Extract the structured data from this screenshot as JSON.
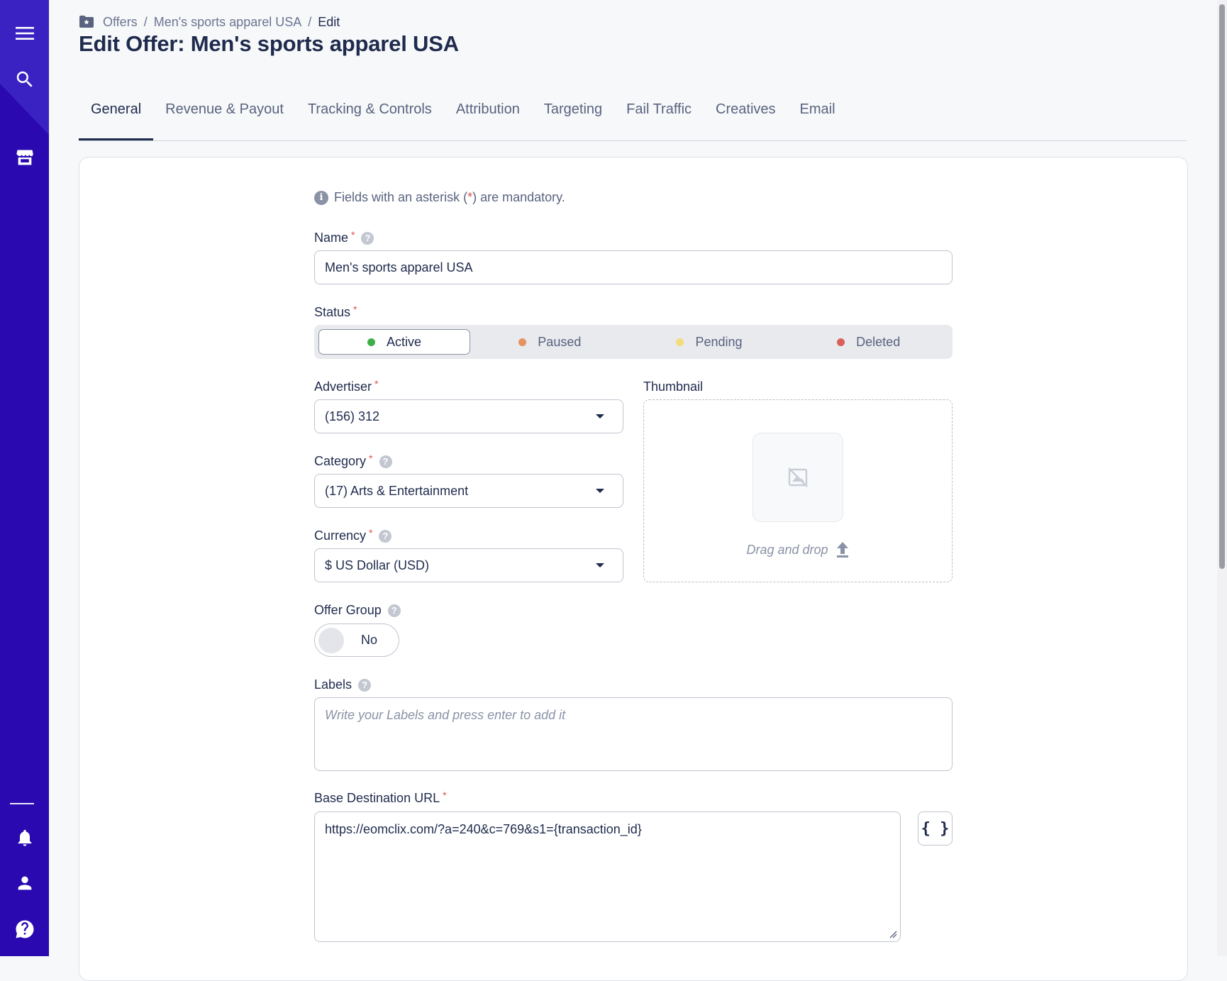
{
  "breadcrumb": {
    "items": [
      "Offers",
      "Men's sports apparel USA",
      "Edit"
    ],
    "separator": "/"
  },
  "page_title": "Edit Offer: Men's sports apparel USA",
  "tabs": [
    {
      "label": "General",
      "active": true
    },
    {
      "label": "Revenue & Payout",
      "active": false
    },
    {
      "label": "Tracking & Controls",
      "active": false
    },
    {
      "label": "Attribution",
      "active": false
    },
    {
      "label": "Targeting",
      "active": false
    },
    {
      "label": "Fail Traffic",
      "active": false
    },
    {
      "label": "Creatives",
      "active": false
    },
    {
      "label": "Email",
      "active": false
    }
  ],
  "note": {
    "prefix": "Fields with an asterisk (",
    "asterisk": "*",
    "suffix": ") are mandatory."
  },
  "form": {
    "name": {
      "label": "Name",
      "value": "Men's sports apparel USA"
    },
    "status": {
      "label": "Status",
      "options": [
        {
          "label": "Active",
          "color": "#3fae49",
          "selected": true
        },
        {
          "label": "Paused",
          "color": "#e5935f",
          "selected": false
        },
        {
          "label": "Pending",
          "color": "#f3dc7a",
          "selected": false
        },
        {
          "label": "Deleted",
          "color": "#d9605c",
          "selected": false
        }
      ]
    },
    "advertiser": {
      "label": "Advertiser",
      "value": "(156) 312"
    },
    "category": {
      "label": "Category",
      "value": "(17) Arts & Entertainment"
    },
    "currency": {
      "label": "Currency",
      "value": "$ US Dollar (USD)"
    },
    "thumbnail": {
      "label": "Thumbnail",
      "drag_text": "Drag and drop"
    },
    "offer_group": {
      "label": "Offer Group",
      "value": "No"
    },
    "labels": {
      "label": "Labels",
      "placeholder": "Write your Labels and press enter to add it"
    },
    "base_url": {
      "label": "Base Destination URL",
      "value": "https://eomclix.com/?a=240&c=769&s1={transaction_id}",
      "macro_button": "{ }"
    }
  },
  "sidebar": {
    "icons": [
      "menu-icon",
      "search-icon",
      "store-icon",
      "bell-icon",
      "user-icon",
      "help-icon"
    ]
  },
  "colors": {
    "sidebar": "#2a0ab0",
    "accent": "#1f2b4d",
    "required": "#e0504c"
  }
}
